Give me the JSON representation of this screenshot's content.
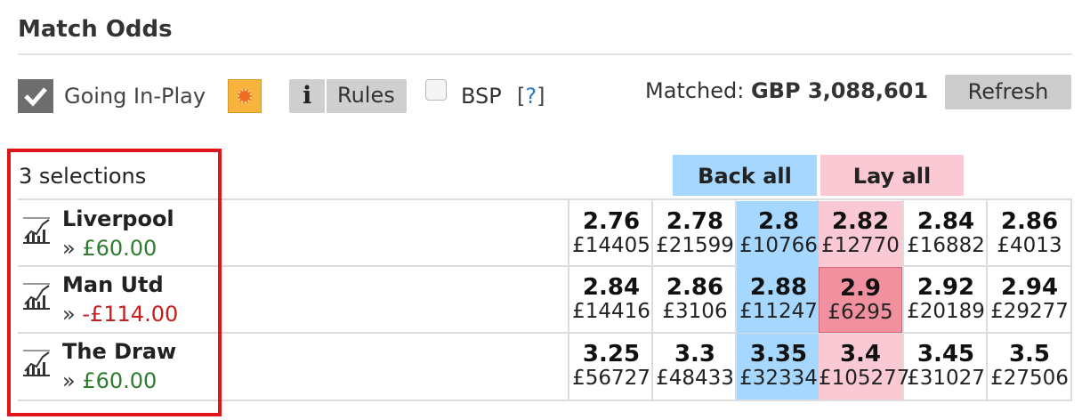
{
  "market": {
    "title": "Match Odds",
    "going_in_play_label": "Going In-Play",
    "rules_icon": "i",
    "rules_label": "Rules",
    "bsp_label": "BSP",
    "bsp_help_open": "[",
    "bsp_help_q": "?",
    "bsp_help_close": "]",
    "matched_label": "Matched:",
    "matched_value": "GBP 3,088,601",
    "refresh_label": "Refresh"
  },
  "table": {
    "selections_label": "3 selections",
    "back_all_label": "Back all",
    "lay_all_label": "Lay all"
  },
  "colors": {
    "back": "#a6d8ff",
    "lay": "#fac9d4",
    "lay_highlight": "#f1909f",
    "profit": "#2e7d2e",
    "loss": "#c61d1d",
    "frame": "#e0151a"
  },
  "runners": [
    {
      "name": "Liverpool",
      "pl_prefix": "»",
      "pl_value": "£60.00",
      "pl_sign": "pos",
      "prices": [
        {
          "price": "2.76",
          "size": "£14405"
        },
        {
          "price": "2.78",
          "size": "£21599"
        },
        {
          "price": "2.8",
          "size": "£10766"
        },
        {
          "price": "2.82",
          "size": "£12770"
        },
        {
          "price": "2.84",
          "size": "£16882"
        },
        {
          "price": "2.86",
          "size": "£4013"
        }
      ]
    },
    {
      "name": "Man Utd",
      "pl_prefix": "»",
      "pl_value": "-£114.00",
      "pl_sign": "neg",
      "prices": [
        {
          "price": "2.84",
          "size": "£14416"
        },
        {
          "price": "2.86",
          "size": "£3106"
        },
        {
          "price": "2.88",
          "size": "£11247"
        },
        {
          "price": "2.9",
          "size": "£6295"
        },
        {
          "price": "2.92",
          "size": "£20189"
        },
        {
          "price": "2.94",
          "size": "£29277"
        }
      ]
    },
    {
      "name": "The Draw",
      "pl_prefix": "»",
      "pl_value": "£60.00",
      "pl_sign": "pos",
      "prices": [
        {
          "price": "3.25",
          "size": "£56727"
        },
        {
          "price": "3.3",
          "size": "£48433"
        },
        {
          "price": "3.35",
          "size": "£32334"
        },
        {
          "price": "3.4",
          "size": "£105277"
        },
        {
          "price": "3.45",
          "size": "£31027"
        },
        {
          "price": "3.5",
          "size": "£27506"
        }
      ]
    }
  ]
}
